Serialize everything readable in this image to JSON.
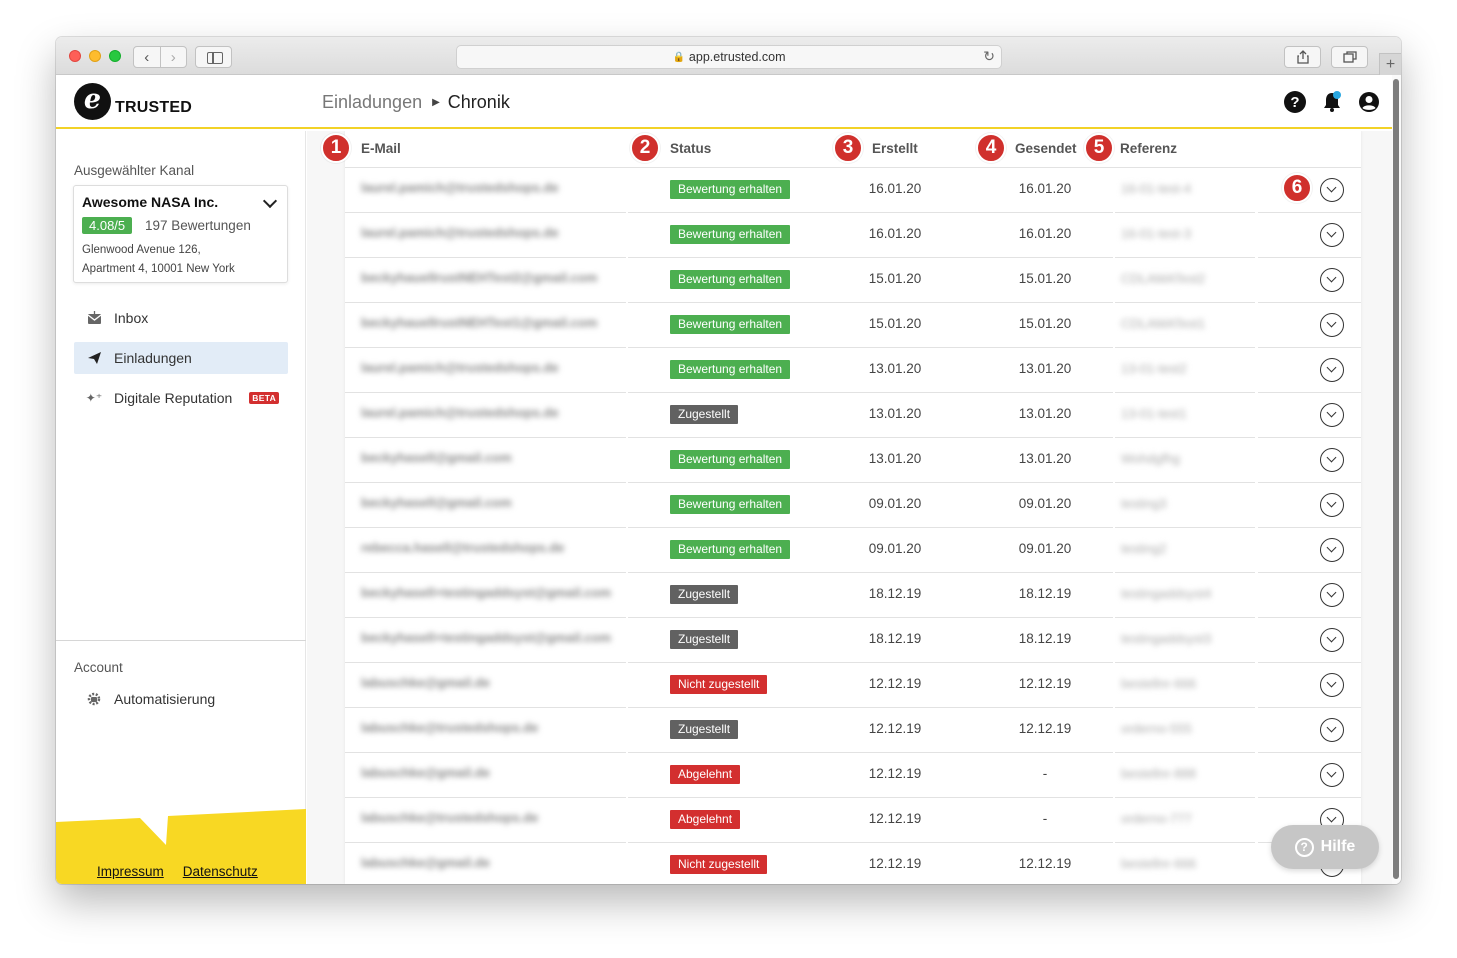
{
  "browser": {
    "url": "app.etrusted.com"
  },
  "header": {
    "logo_text": "TRUSTED",
    "logo_letter": "e",
    "breadcrumb_parent": "Einladungen",
    "breadcrumb_current": "Chronik",
    "help_label": "?"
  },
  "sidebar": {
    "channel_section_label": "Ausgewählter Kanal",
    "channel": {
      "name": "Awesome NASA Inc.",
      "rating": "4.08/5",
      "review_count": "197 Bewertungen",
      "address_line1": "Glenwood Avenue 126,",
      "address_line2": "Apartment 4, 10001 New York"
    },
    "nav": [
      {
        "label": "Inbox",
        "icon": "inbox-icon"
      },
      {
        "label": "Einladungen",
        "icon": "paper-plane-icon"
      },
      {
        "label": "Digitale Reputation",
        "icon": "stars-icon",
        "badge": "BETA"
      }
    ],
    "account_label": "Account",
    "account_items": [
      {
        "label": "Automatisierung",
        "icon": "gear-robot-icon"
      }
    ],
    "footer": {
      "impressum": "Impressum",
      "datenschutz": "Datenschutz"
    }
  },
  "table": {
    "columns": {
      "email": "E-Mail",
      "status": "Status",
      "created": "Erstellt",
      "sent": "Gesendet",
      "reference": "Referenz"
    },
    "markers": [
      "1",
      "2",
      "3",
      "4",
      "5",
      "6"
    ],
    "rows": [
      {
        "email": "laurel.pamich@trustedshops.de",
        "status": "Bewertung erhalten",
        "status_type": "received",
        "created": "16.01.20",
        "sent": "16.01.20",
        "reference": "16-01-test-4"
      },
      {
        "email": "laurel.pamich@trustedshops.de",
        "status": "Bewertung erhalten",
        "status_type": "received",
        "created": "16.01.20",
        "sent": "16.01.20",
        "reference": "16-01-test-3"
      },
      {
        "email": "beckyhauellrustNEHTest2@gmail.com",
        "status": "Bewertung erhalten",
        "status_type": "received",
        "created": "15.01.20",
        "sent": "15.01.20",
        "reference": "CDLAMATest2"
      },
      {
        "email": "beckyhauellrustNEHTest1@gmail.com",
        "status": "Bewertung erhalten",
        "status_type": "received",
        "created": "15.01.20",
        "sent": "15.01.20",
        "reference": "CDLAMATest1"
      },
      {
        "email": "laurel.pamich@trustedshops.de",
        "status": "Bewertung erhalten",
        "status_type": "received",
        "created": "13.01.20",
        "sent": "13.01.20",
        "reference": "13-01-test2"
      },
      {
        "email": "laurel.pamich@trustedshops.de",
        "status": "Zugestellt",
        "status_type": "delivered",
        "created": "13.01.20",
        "sent": "13.01.20",
        "reference": "13-01-test1"
      },
      {
        "email": "beckyhasell@gmail.com",
        "status": "Bewertung erhalten",
        "status_type": "received",
        "created": "13.01.20",
        "sent": "13.01.20",
        "reference": "Wohdgfhg"
      },
      {
        "email": "beckyhasell@gmail.com",
        "status": "Bewertung erhalten",
        "status_type": "received",
        "created": "09.01.20",
        "sent": "09.01.20",
        "reference": "testing3"
      },
      {
        "email": "rebecca.hasell@trustedshops.de",
        "status": "Bewertung erhalten",
        "status_type": "received",
        "created": "09.01.20",
        "sent": "09.01.20",
        "reference": "testing2"
      },
      {
        "email": "beckyhasell+testingaddsyst@gmail.com",
        "status": "Zugestellt",
        "status_type": "delivered",
        "created": "18.12.19",
        "sent": "18.12.19",
        "reference": "testingaddsyst4"
      },
      {
        "email": "beckyhasell+testingaddsyst@gmail.com",
        "status": "Zugestellt",
        "status_type": "delivered",
        "created": "18.12.19",
        "sent": "18.12.19",
        "reference": "testingaddsyst3"
      },
      {
        "email": "labuschke@gmail.de",
        "status": "Nicht zugestellt",
        "status_type": "notdelivered",
        "created": "12.12.19",
        "sent": "12.12.19",
        "reference": "bestellnr-666"
      },
      {
        "email": "labuschke@trustedshops.de",
        "status": "Zugestellt",
        "status_type": "delivered",
        "created": "12.12.19",
        "sent": "12.12.19",
        "reference": "orderno-555"
      },
      {
        "email": "labuschke@gmail.de",
        "status": "Abgelehnt",
        "status_type": "declined",
        "created": "12.12.19",
        "sent": "-",
        "reference": "bestellnr-888"
      },
      {
        "email": "labuschke@trustedshops.de",
        "status": "Abgelehnt",
        "status_type": "declined",
        "created": "12.12.19",
        "sent": "-",
        "reference": "orderno-777"
      },
      {
        "email": "labuschke@gmail.de",
        "status": "Nicht zugestellt",
        "status_type": "notdelivered",
        "created": "12.12.19",
        "sent": "12.12.19",
        "reference": "bestellnr-666"
      }
    ]
  },
  "help_button": {
    "label": "Hilfe"
  },
  "colors": {
    "accent_yellow": "#f8d823",
    "status_green": "#4caf50",
    "status_gray": "#616161",
    "status_red": "#d32f2f",
    "marker_red": "#d0302c",
    "active_nav_bg": "#e2ecf7"
  }
}
